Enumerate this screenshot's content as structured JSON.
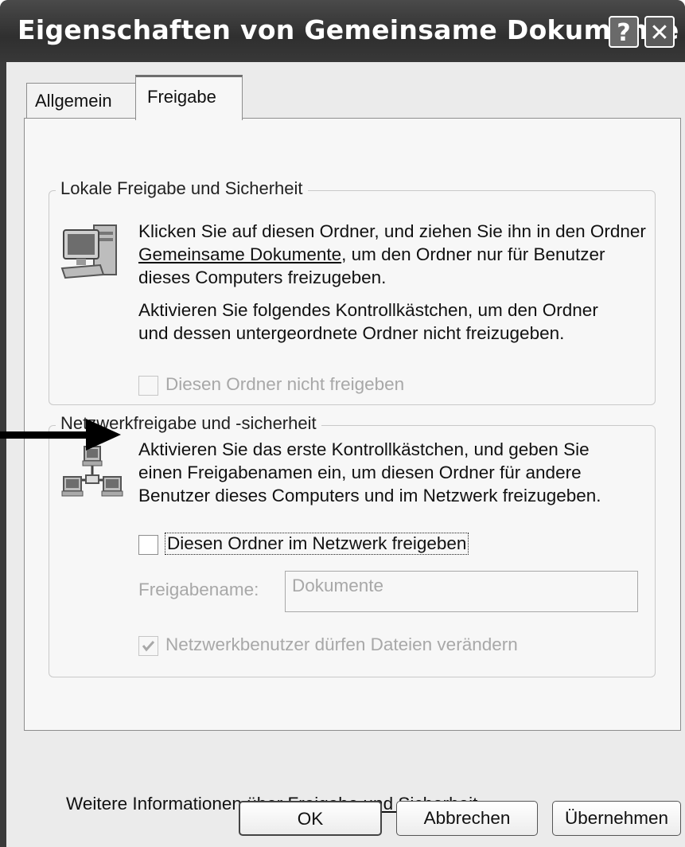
{
  "window": {
    "title": "Eigenschaften von Gemeinsame Dokumente",
    "help_glyph": "?",
    "close_glyph": "✕"
  },
  "tabs": [
    {
      "label": "Allgemein",
      "selected": false
    },
    {
      "label": "Freigabe",
      "selected": true
    }
  ],
  "local_group": {
    "legend": "Lokale Freigabe und Sicherheit",
    "icon": "computer-icon",
    "text1_part1": "Klicken Sie auf diesen Ordner, und ziehen Sie ihn in den Ordner ",
    "text1_link": "Gemeinsame Dokumente",
    "text1_part2": ", um den Ordner nur für Benutzer dieses Computers freizugeben.",
    "text2": "Aktivieren Sie folgendes Kontrollkästchen, um den Ordner und dessen untergeordnete Ordner nicht freizugeben.",
    "checkbox_label": "Diesen Ordner nicht freigeben",
    "checkbox_checked": false,
    "checkbox_enabled": false
  },
  "network_group": {
    "legend": "Netzwerkfreigabe und -sicherheit",
    "icon": "network-icon",
    "text": "Aktivieren Sie das erste Kontrollkästchen, und geben Sie einen Freigabenamen ein, um diesen Ordner für andere Benutzer dieses Computers und im Netzwerk freizugeben.",
    "share_checkbox_label": "Diesen Ordner im Netzwerk freigeben",
    "share_checkbox_checked": false,
    "share_name_label": "Freigabename:",
    "share_name_value": "Dokumente",
    "modify_checkbox_label": "Netzwerkbenutzer dürfen Dateien verändern",
    "modify_checkbox_checked": true,
    "modify_checkbox_enabled": false
  },
  "footer": {
    "info_prefix": "Weitere Informationen über ",
    "info_link": "Freigabe und Sicherheit"
  },
  "buttons": {
    "ok": "OK",
    "cancel": "Abbrechen",
    "apply": "Übernehmen"
  },
  "annotation": {
    "arrow_icon": "arrow-right-icon"
  }
}
